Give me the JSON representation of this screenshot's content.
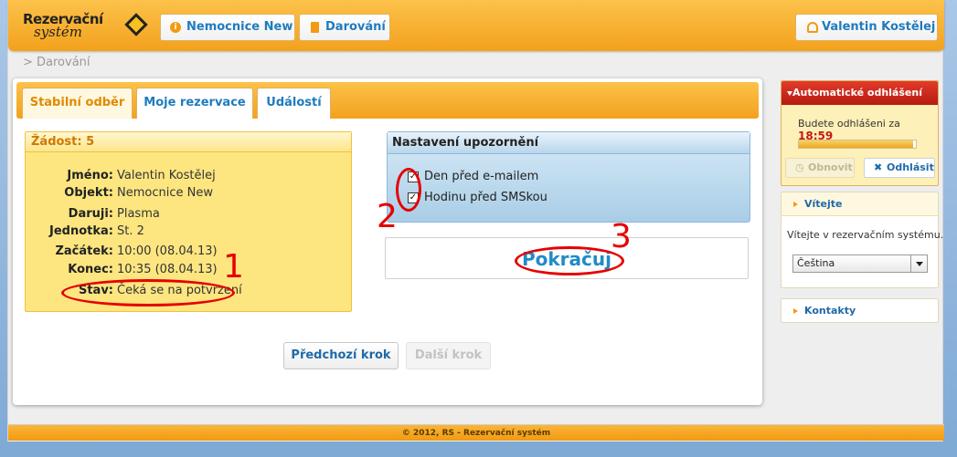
{
  "header": {
    "logo_line1": "Rezervační",
    "logo_line2": "systém",
    "nav": [
      {
        "label": "Nemocnice New",
        "icon": "info-icon"
      },
      {
        "label": "Darování",
        "icon": "book-icon"
      }
    ],
    "user": {
      "label": "Valentin Kostělej",
      "icon": "user-icon"
    }
  },
  "breadcrumb": "> Darování",
  "tabs": [
    {
      "label": "Stabilní odběr",
      "active": true
    },
    {
      "label": "Moje rezervace",
      "active": false
    },
    {
      "label": "Událostí",
      "active": false
    }
  ],
  "request": {
    "title": "Žádost: 5",
    "fields": [
      {
        "label": "Jméno:",
        "value": "Valentin Kostělej"
      },
      {
        "label": "Objekt:",
        "value": "Nemocnice New"
      },
      {
        "label": "Daruji:",
        "value": "Plasma"
      },
      {
        "label": "Jednotka:",
        "value": "St. 2"
      },
      {
        "label": "Začátek:",
        "value": "10:00 (08.04.13)"
      },
      {
        "label": "Konec:",
        "value": "10:35 (08.04.13)"
      },
      {
        "label": "Stav:",
        "value": "Čeká se na potvrzení"
      }
    ]
  },
  "notifications": {
    "title": "Nastavení upozornění",
    "options": [
      {
        "label": "Den před e-mailem",
        "checked": true
      },
      {
        "label": "Hodinu před SMSkou",
        "checked": true
      }
    ]
  },
  "continue_label": "Pokračuj",
  "buttons": {
    "prev": "Předchozí krok",
    "next": "Další krok"
  },
  "sidebar": {
    "logout_box": {
      "title": "Automatické odhlášení",
      "text": "Budete odhlášeni za",
      "time": "18:59",
      "progress": 0.98,
      "refresh": "Obnovit",
      "logout": "Odhlásit"
    },
    "welcome_box": {
      "title": "Vítejte",
      "text": "Vítejte v rezervačním systému.",
      "language": "Čeština"
    },
    "contacts": "Kontakty"
  },
  "footer": "© 2012, RS - Rezervační systém",
  "annotations": [
    "1",
    "2",
    "3"
  ],
  "colors": {
    "accent_orange": "#f3a11d",
    "link_blue": "#1f7bbf",
    "annotation_red": "#e60000",
    "alert_red": "#c41a10"
  }
}
